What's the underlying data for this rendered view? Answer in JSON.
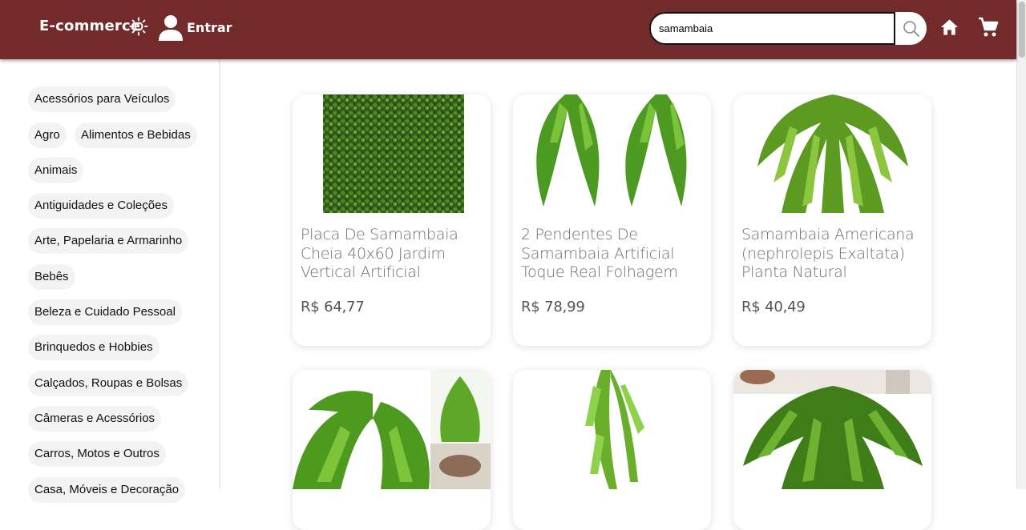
{
  "header": {
    "brand": "E-commerce",
    "login_label": "Entrar",
    "bg_color": "#732a2a"
  },
  "search": {
    "value": "samambaia",
    "placeholder": ""
  },
  "sidebar": {
    "categories": [
      "Acessórios para Veículos",
      "Agro",
      "Alimentos e Bebidas",
      "Animais",
      "Antiguidades e Coleções",
      "Arte, Papelaria e Armarinho",
      "Bebês",
      "Beleza e Cuidado Pessoal",
      "Brinquedos e Hobbies",
      "Calçados, Roupas e Bolsas",
      "Câmeras e Acessórios",
      "Carros, Motos e Outros",
      "Casa, Móveis e Decoração"
    ]
  },
  "products": [
    {
      "title": "Placa De Samambaia Cheia 40x60 Jardim Vertical Artificial",
      "price": "R$ 64,77"
    },
    {
      "title": "2 Pendentes De Samambaia Artificial Toque Real Folhagem",
      "price": "R$ 78,99"
    },
    {
      "title": "Samambaia Americana (nephrolepis Exaltata) Planta Natural",
      "price": "R$ 40,49"
    },
    {
      "title": "",
      "price": ""
    },
    {
      "title": "",
      "price": ""
    },
    {
      "title": "",
      "price": ""
    }
  ]
}
